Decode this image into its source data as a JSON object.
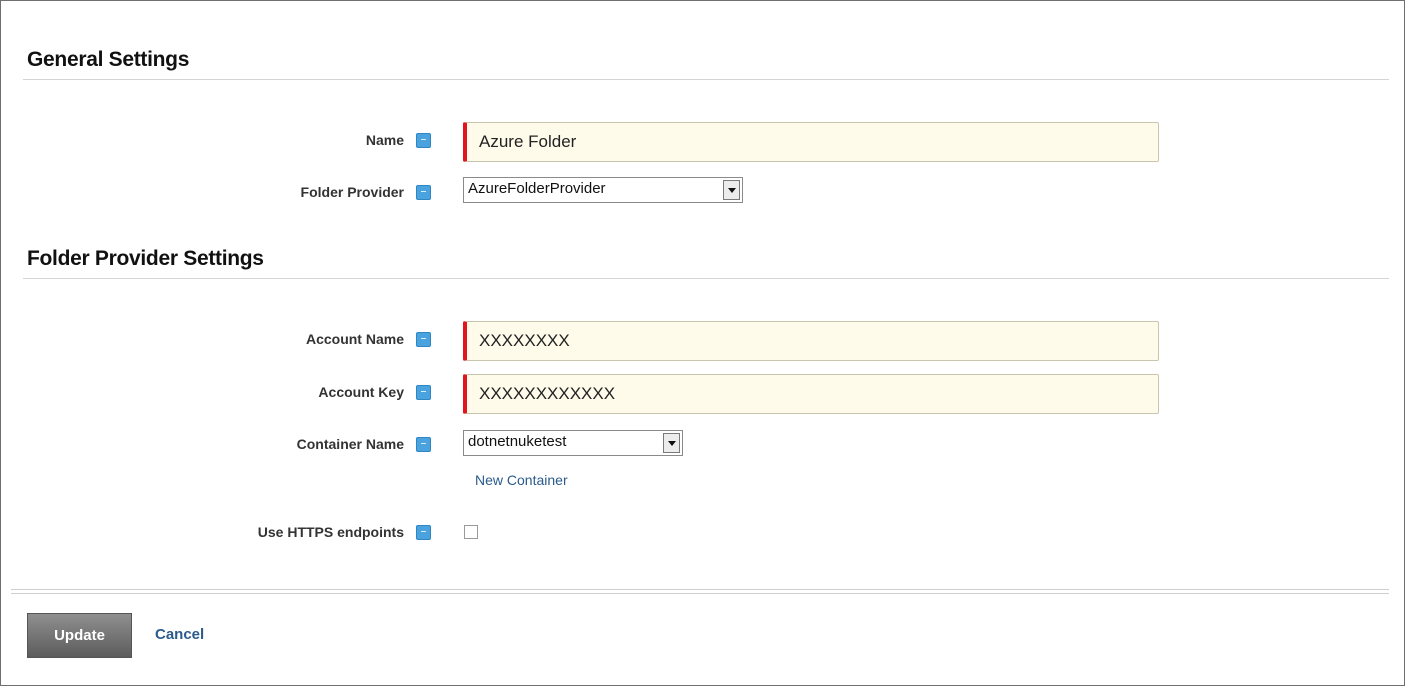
{
  "general_settings": {
    "title": "General Settings",
    "name_label": "Name",
    "name_value": "Azure Folder",
    "folder_provider_label": "Folder Provider",
    "folder_provider_value": "AzureFolderProvider"
  },
  "folder_provider_settings": {
    "title": "Folder Provider Settings",
    "account_name_label": "Account Name",
    "account_name_value": "XXXXXXXX",
    "account_key_label": "Account Key",
    "account_key_value": "XXXXXXXXXXXX",
    "container_name_label": "Container Name",
    "container_name_value": "dotnetnuketest",
    "new_container_link": "New Container",
    "https_label": "Use HTTPS endpoints",
    "https_checked": false
  },
  "actions": {
    "update_label": "Update",
    "cancel_label": "Cancel"
  },
  "colors": {
    "required_marker": "#e0161c",
    "input_background": "#fefbea",
    "help_icon": "#4aa3df",
    "link": "#2a5b8c"
  },
  "icons": {
    "help": "help-icon",
    "dropdown": "chevron-down-icon"
  }
}
